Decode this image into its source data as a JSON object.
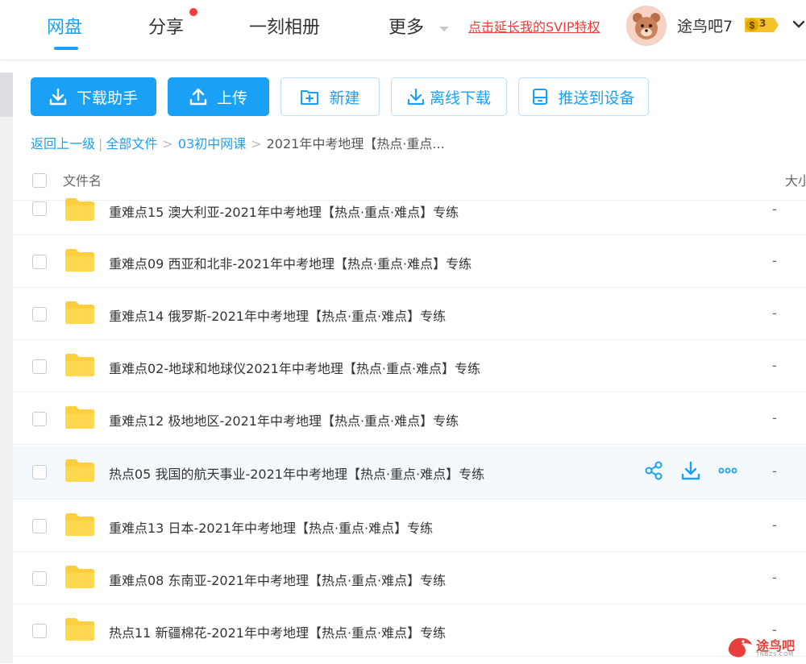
{
  "nav": {
    "tabs": [
      {
        "label": "网盘",
        "active": true
      },
      {
        "label": "分享"
      },
      {
        "label": "一刻相册"
      },
      {
        "label": "更多"
      }
    ],
    "svip_link": "点击延长我的SVIP特权",
    "username": "途鸟吧7",
    "vip_level": "3",
    "vip_badge_symbol": "$"
  },
  "toolbar": {
    "download_helper": "下载助手",
    "upload": "上传",
    "new": "新建",
    "offline_download": "离线下载",
    "push_to_device": "推送到设备"
  },
  "breadcrumb": {
    "back": "返回上一级",
    "all_files": "全部文件",
    "folder_1": "03初中网课",
    "current": "2021年中考地理【热点·重点..."
  },
  "list_header": {
    "name": "文件名",
    "size": "大小"
  },
  "files": [
    {
      "name": "重难点15 澳大利亚-2021年中考地理【热点·重点·难点】专练",
      "size": "-"
    },
    {
      "name": "重难点09 西亚和北非-2021年中考地理【热点·重点·难点】专练",
      "size": "-"
    },
    {
      "name": "重难点14 俄罗斯-2021年中考地理【热点·重点·难点】专练",
      "size": "-"
    },
    {
      "name": "重难点02-地球和地球仪2021年中考地理【热点·重点·难点】专练",
      "size": "-"
    },
    {
      "name": "重难点12 极地地区-2021年中考地理【热点·重点·难点】专练",
      "size": "-"
    },
    {
      "name": "热点05 我国的航天事业-2021年中考地理【热点·重点·难点】专练",
      "size": "-"
    },
    {
      "name": "重难点13 日本-2021年中考地理【热点·重点·难点】专练",
      "size": "-"
    },
    {
      "name": "重难点08 东南亚-2021年中考地理【热点·重点·难点】专练",
      "size": "-"
    },
    {
      "name": "热点11 新疆棉花-2021年中考地理【热点·重点·难点】专练",
      "size": "-"
    }
  ],
  "watermark": {
    "text": "途鸟吧",
    "sub": "TNBZS.COM"
  },
  "colors": {
    "accent": "#1aa1f5",
    "svip_red": "#e8403b",
    "folder_yellow": "#ffcf3d",
    "row_hover": "#f4f9fe"
  }
}
